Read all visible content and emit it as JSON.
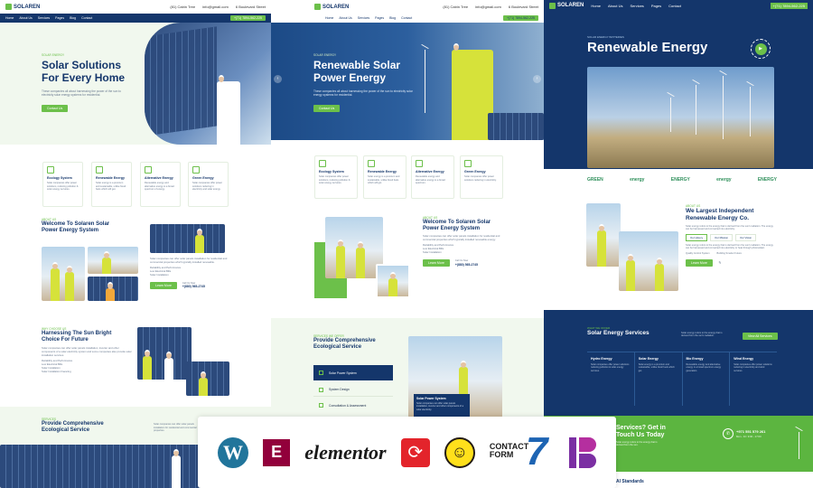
{
  "brand": {
    "name": "SOLAREN",
    "green": "#6cc04a",
    "navy": "#14366b"
  },
  "nav": {
    "items": [
      "Home",
      "About Us",
      "Services",
      "Pages",
      "Blog",
      "Contact"
    ],
    "phone": "+(71) 7894-562-225"
  },
  "contact": {
    "call_label": "Contact us",
    "call_value": "(81) Cabin Tree",
    "email_label": "Email us",
    "email_value": "info@gmail.com",
    "addr_label": "Address",
    "addr_value": "6 Boulevard Street"
  },
  "col1": {
    "tag": "SOLAR ENERGY",
    "hero_title_1": "Solar Solutions",
    "hero_title_2": "For Every Home",
    "hero_text": "These companies all about harnessing the power of the sun to electricity solar energy systems for residential.",
    "hero_btn": "Contact Us",
    "cards": [
      {
        "title": "Ecology System",
        "text": "Solar companies offer power solutions, reducing pollution & solar energy services."
      },
      {
        "title": "Renewable Energy",
        "text": "Solar energy is a premium and sustainable, unlike fossil fuels which will get."
      },
      {
        "title": "Alternative Energy",
        "text": "Renewable energy and alternative energy is a broad spectrum of energy."
      },
      {
        "title": "Green Energy",
        "text": "Solar companies offer power solutions reducing in electricity and solar energy."
      }
    ],
    "about_tag": "ABOUT US",
    "about_title_1": "Welcome To Solaren Solar",
    "about_title_2": "Power Energy System",
    "about_text": "Solar companies can offer solar panels installation for residential and commercial properties which typically installed renewable.",
    "about_list": [
      "Reliability and Performance",
      "Low Electrical Bills",
      "Solar Installation"
    ],
    "about_btn": "Learn More",
    "about_call_label": "Call Us Now",
    "about_call_value": "+(880) 565-2745",
    "why_tag": "WHY CHOOSE US",
    "why_title_1": "Harnessing The Sun Bright",
    "why_title_2": "Choice For Future",
    "why_text": "Solar companies can offer solar panels installation, inverter and other components of a solar electricity system and some companies also provide solar installation services.",
    "why_list": [
      "Reliability and Performance",
      "Low Electrical Bills",
      "Solar Installation",
      "Solar Installation financing"
    ],
    "services_tag": "SERVICES",
    "services_title_1": "Provide Comprehensive",
    "services_title_2": "Ecological Service",
    "services_text": "Solar companies can offer solar panels installation for residential and commercial properties."
  },
  "col2": {
    "tag": "SOLAR ENERGY",
    "hero_title_1": "Renewable Solar",
    "hero_title_2": "Power Energy",
    "hero_text": "These companies all about harnessing the power of the sun to electricity solar energy systems for residential.",
    "hero_btn": "Contact Us",
    "cards": [
      {
        "title": "Ecology System",
        "text": "Solar companies offer power solutions, reducing pollution & solar energy services."
      },
      {
        "title": "Renewable Energy",
        "text": "Solar energy is a premium and sustainable, unlike fossil fuels which will get."
      },
      {
        "title": "Alternative Energy",
        "text": "Renewable energy and alternative energy is a broad spectrum."
      },
      {
        "title": "Green Energy",
        "text": "Solar companies offer power solutions reducing in electricity."
      }
    ],
    "about_tag": "ABOUT US",
    "about_title_1": "Welcome To Solaren Solar",
    "about_title_2": "Power Energy System",
    "about_text": "Solar companies can offer solar panels installation for residential and commercial properties which typically installed renewable energy.",
    "about_list": [
      "Reliability and Performance",
      "Low Electrical Bills",
      "Solar Installation"
    ],
    "about_btn": "Learn More",
    "about_call_label": "Call Us Now",
    "about_call_value": "+(880) 565-2745",
    "services_tag": "SERVICES WE OFFER",
    "services_title_1": "Provide Comprehensive",
    "services_title_2": "Ecological Service",
    "service_items": [
      "Solar Power System",
      "System Design",
      "Consultation & Assessment"
    ],
    "service_card_title": "Solar Power System",
    "service_card_text": "Solar companies can offer solar panels installation, inverter and other components of a solar electricity."
  },
  "col3": {
    "tag": "SOLAR ENERGY BATTERIES",
    "hero_title": "Renewable Energy",
    "hero_text": "Solar companies can offer solar panels installation with battery storage systems to store excess energy.",
    "partners": [
      "GREEN",
      "energy",
      "ENERGY",
      "energy",
      "ENERGY"
    ],
    "about_tag": "ABOUT US",
    "about_title_1": "We Largest Independent",
    "about_title_2": "Renewable Energy Co.",
    "about_text": "Solar energy refers to the energy that is derived from the sun's radiation. The energy can be harnessed and converted into electricity.",
    "about_tabs": [
      "Our History",
      "Our Mission",
      "Our Vision"
    ],
    "about_body": "Solar energy refers to the energy that is derived from the sun's radiation. The energy can be harnessed and converted into electricity or heat through photovoltaic.",
    "about_list": [
      "Quality Control System",
      "Building Smarter Future"
    ],
    "about_btn": "Learn More",
    "services_tag": "WHAT WE OFFER",
    "services_title": "Solar Energy Services",
    "services_text": "Solar energy refers to the energy that is derived from the sun's radiation.",
    "services_btn": "View All Services",
    "services": [
      {
        "title": "Hydro Energy",
        "text": "Solar companies offer power solutions reducing pollution & solar energy services."
      },
      {
        "title": "Solar Energy",
        "text": "Solar energy is a premium and sustainable, unlike fossil fuels which get."
      },
      {
        "title": "Bio Energy",
        "text": "Renewable energy and alternative energy is a broad spectrum energy generation."
      },
      {
        "title": "Wind Energy",
        "text": "Solar companies offer power solutions reducing in electricity and wind services."
      }
    ],
    "cta_title_1": "Services? Get in",
    "cta_title_2": "Touch Us Today",
    "cta_text": "Solar energy refers to the energy that is derived from the sun.",
    "cta_phone": "+971 551 579 261",
    "cta_hours": "Mon - Fri: 9:00 - 17:00",
    "standards": "Al Standards"
  },
  "plugins": {
    "elementor_text": "elementor",
    "contact_form_1": "CONTACT",
    "contact_form_2": "FORM",
    "contact_form_7": "7"
  }
}
